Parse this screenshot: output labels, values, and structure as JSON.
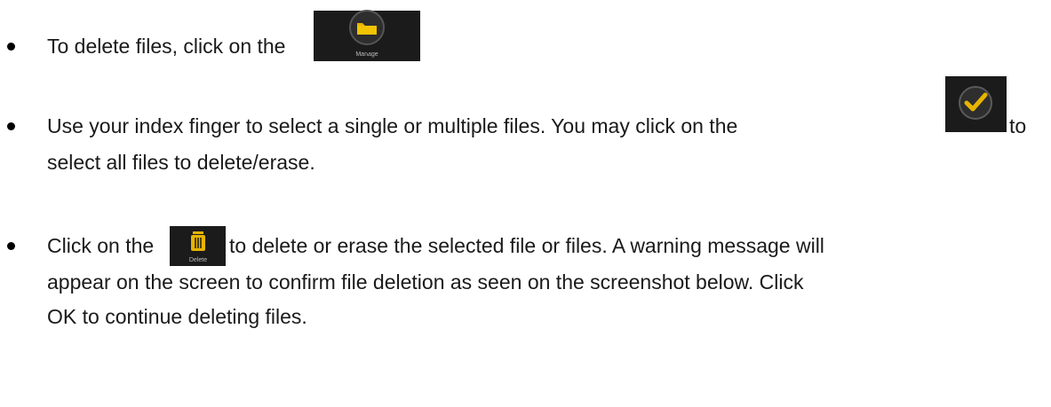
{
  "items": [
    {
      "before_icon": "To delete files, click on the",
      "icon": "manage-folder-icon",
      "icon_caption": "Manage",
      "after_icon": "."
    },
    {
      "before_icon": "Use your index finger to select a single or multiple files.  You may click on the",
      "icon": "select-all-checkmark-icon",
      "after_icon": "to",
      "line2": "select all files to delete/erase."
    },
    {
      "before_icon": "Click on the",
      "icon": "delete-trash-icon",
      "icon_caption": "Delete",
      "after_icon": "to delete or erase the selected file or files.  A warning message will",
      "line2": "appear on the screen to confirm file deletion as seen on the screenshot below.  Click",
      "line3": "OK to continue deleting files."
    }
  ],
  "colors": {
    "text": "#1a1a1a",
    "icon_background": "#1b1b1b",
    "icon_accent": "#e8b400"
  }
}
